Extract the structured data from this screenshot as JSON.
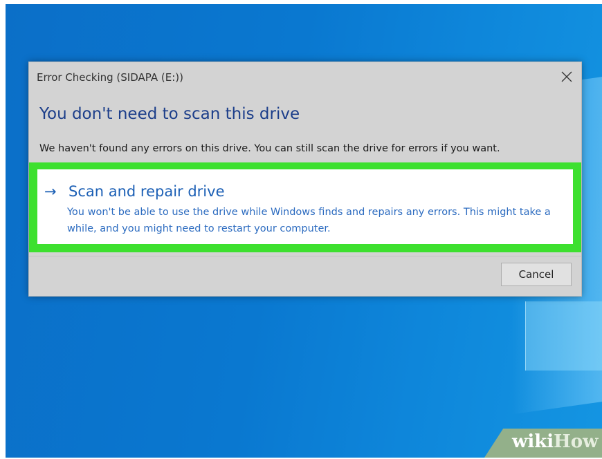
{
  "dialog": {
    "title": "Error Checking (SIDAPA (E:))",
    "close_icon": "close-icon",
    "heading": "You don't need to scan this drive",
    "description": "We haven't found any errors on this drive. You can still scan the drive for errors if you want.",
    "option": {
      "arrow_icon": "arrow-right-icon",
      "arrow_glyph": "→",
      "title": "Scan and repair drive",
      "description": "You won't be able to use the drive while Windows finds and repairs any errors. This might take a while, and you might need to restart your computer."
    },
    "cancel_label": "Cancel"
  },
  "watermark": {
    "wiki": "wiki",
    "how": "How"
  },
  "colors": {
    "desktop": "#0a78d0",
    "dialog_bg": "#d3d3d3",
    "highlight": "#3de02f",
    "link_blue": "#1b5fb5",
    "heading_blue": "#1c3e8a"
  }
}
